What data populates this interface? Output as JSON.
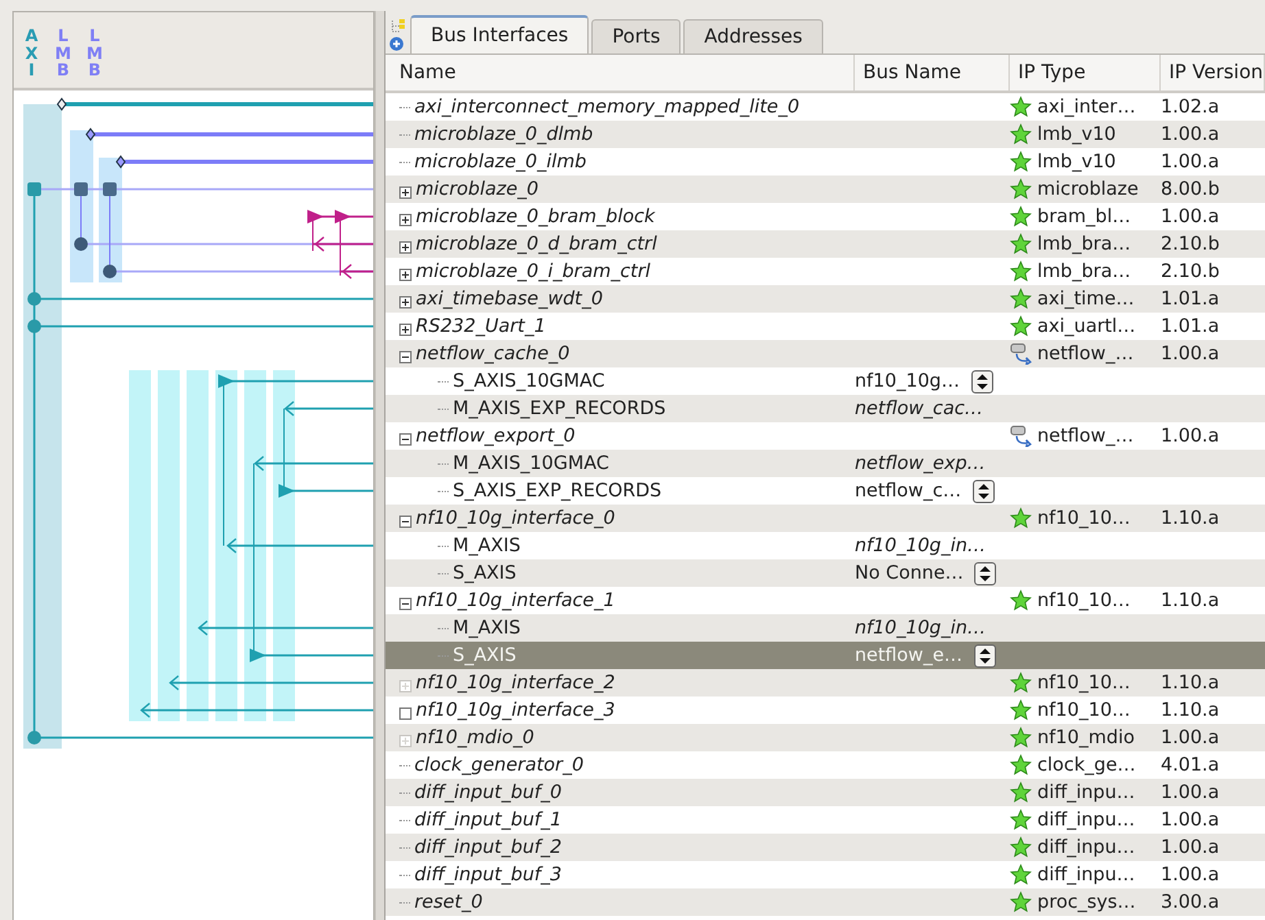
{
  "bus_labels": [
    {
      "text": "AXI",
      "color": "#2a9cb3"
    },
    {
      "text": "LMB",
      "color": "#7f7ff5"
    },
    {
      "text": "LMB",
      "color": "#7f7ff5"
    }
  ],
  "tabs": [
    {
      "label": "Bus Interfaces",
      "selected": true
    },
    {
      "label": "Ports",
      "selected": false
    },
    {
      "label": "Addresses",
      "selected": false
    }
  ],
  "columns": [
    "Name",
    "Bus Name",
    "IP Type",
    "IP Version"
  ],
  "rows": [
    {
      "name": "axi_interconnect_memory_mapped_lite_0",
      "kind": "leaf",
      "selected": false,
      "ip_type": {
        "kind": "star",
        "text": "axi_inter…"
      },
      "ip_version": "1.02.a"
    },
    {
      "name": "microblaze_0_dlmb",
      "kind": "leaf",
      "selected": false,
      "ip_type": {
        "kind": "star",
        "text": "lmb_v10"
      },
      "ip_version": "1.00.a"
    },
    {
      "name": "microblaze_0_ilmb",
      "kind": "leaf",
      "selected": false,
      "ip_type": {
        "kind": "star",
        "text": "lmb_v10"
      },
      "ip_version": "1.00.a"
    },
    {
      "name": "microblaze_0",
      "kind": "plus",
      "selected": false,
      "ip_type": {
        "kind": "star",
        "text": "microblaze"
      },
      "ip_version": "8.00.b"
    },
    {
      "name": "microblaze_0_bram_block",
      "kind": "plus",
      "selected": false,
      "ip_type": {
        "kind": "star",
        "text": "bram_bl…"
      },
      "ip_version": "1.00.a"
    },
    {
      "name": "microblaze_0_d_bram_ctrl",
      "kind": "plus",
      "selected": false,
      "ip_type": {
        "kind": "star",
        "text": "lmb_bra…"
      },
      "ip_version": "2.10.b"
    },
    {
      "name": "microblaze_0_i_bram_ctrl",
      "kind": "plus",
      "selected": false,
      "ip_type": {
        "kind": "star",
        "text": "lmb_bra…"
      },
      "ip_version": "2.10.b"
    },
    {
      "name": "axi_timebase_wdt_0",
      "kind": "plus",
      "selected": false,
      "ip_type": {
        "kind": "star",
        "text": "axi_time…"
      },
      "ip_version": "1.01.a"
    },
    {
      "name": "RS232_Uart_1",
      "kind": "plus",
      "selected": false,
      "ip_type": {
        "kind": "star",
        "text": "axi_uartl…"
      },
      "ip_version": "1.01.a"
    },
    {
      "name": "netflow_cache_0",
      "kind": "minus",
      "selected": false,
      "ip_type": {
        "kind": "chip",
        "text": "netflow_…"
      },
      "ip_version": "1.00.a",
      "children": [
        {
          "name": "S_AXIS_10GMAC",
          "selected": false,
          "bus_name": {
            "text": "nf10_10g…",
            "editable": true
          }
        },
        {
          "name": "M_AXIS_EXP_RECORDS",
          "selected": false,
          "bus_name": {
            "text": "netflow_cac…",
            "editable": false
          }
        }
      ]
    },
    {
      "name": "netflow_export_0",
      "kind": "minus",
      "selected": false,
      "ip_type": {
        "kind": "chip",
        "text": "netflow_…"
      },
      "ip_version": "1.00.a",
      "children": [
        {
          "name": "M_AXIS_10GMAC",
          "selected": false,
          "bus_name": {
            "text": "netflow_exp…",
            "editable": false
          }
        },
        {
          "name": "S_AXIS_EXP_RECORDS",
          "selected": false,
          "bus_name": {
            "text": "netflow_c…",
            "editable": true
          }
        }
      ]
    },
    {
      "name": "nf10_10g_interface_0",
      "kind": "minus",
      "selected": false,
      "ip_type": {
        "kind": "star",
        "text": "nf10_10…"
      },
      "ip_version": "1.10.a",
      "children": [
        {
          "name": "M_AXIS",
          "selected": false,
          "bus_name": {
            "text": "nf10_10g_in…",
            "editable": false
          }
        },
        {
          "name": "S_AXIS",
          "selected": false,
          "bus_name": {
            "text": "No Conne…",
            "editable": true
          }
        }
      ]
    },
    {
      "name": "nf10_10g_interface_1",
      "kind": "minus",
      "selected": false,
      "ip_type": {
        "kind": "star",
        "text": "nf10_10…"
      },
      "ip_version": "1.10.a",
      "children": [
        {
          "name": "M_AXIS",
          "selected": false,
          "bus_name": {
            "text": "nf10_10g_in…",
            "editable": false
          }
        },
        {
          "name": "S_AXIS",
          "selected": true,
          "bus_name": {
            "text": "netflow_e…",
            "editable": true
          }
        }
      ]
    },
    {
      "name": "nf10_10g_interface_2",
      "kind": "faded",
      "selected": false,
      "ip_type": {
        "kind": "star",
        "text": "nf10_10…"
      },
      "ip_version": "1.10.a"
    },
    {
      "name": "nf10_10g_interface_3",
      "kind": "empty",
      "selected": false,
      "ip_type": {
        "kind": "star",
        "text": "nf10_10…"
      },
      "ip_version": "1.10.a"
    },
    {
      "name": "nf10_mdio_0",
      "kind": "faded",
      "selected": false,
      "ip_type": {
        "kind": "star",
        "text": "nf10_mdio"
      },
      "ip_version": "1.00.a"
    },
    {
      "name": "clock_generator_0",
      "kind": "leaf",
      "selected": false,
      "ip_type": {
        "kind": "star",
        "text": "clock_ge…"
      },
      "ip_version": "4.01.a"
    },
    {
      "name": "diff_input_buf_0",
      "kind": "leaf",
      "selected": false,
      "ip_type": {
        "kind": "star",
        "text": "diff_inpu…"
      },
      "ip_version": "1.00.a"
    },
    {
      "name": "diff_input_buf_1",
      "kind": "leaf",
      "selected": false,
      "ip_type": {
        "kind": "star",
        "text": "diff_inpu…"
      },
      "ip_version": "1.00.a"
    },
    {
      "name": "diff_input_buf_2",
      "kind": "leaf",
      "selected": false,
      "ip_type": {
        "kind": "star",
        "text": "diff_inpu…"
      },
      "ip_version": "1.00.a"
    },
    {
      "name": "diff_input_buf_3",
      "kind": "leaf",
      "selected": false,
      "ip_type": {
        "kind": "star",
        "text": "diff_inpu…"
      },
      "ip_version": "1.00.a"
    },
    {
      "name": "reset_0",
      "kind": "leaf",
      "selected": false,
      "ip_type": {
        "kind": "star",
        "text": "proc_sys…"
      },
      "ip_version": "3.00.a"
    }
  ]
}
